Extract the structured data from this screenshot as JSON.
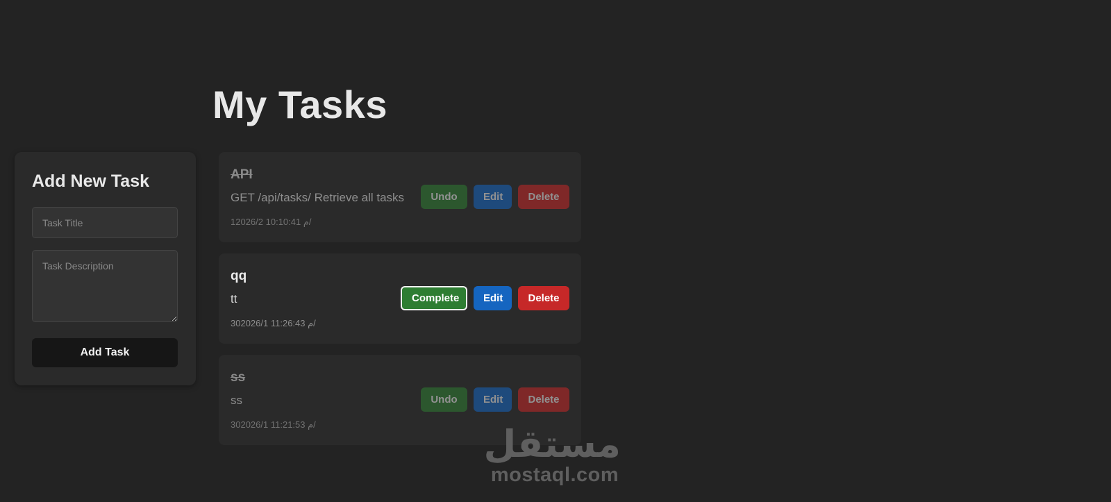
{
  "page_title": "My Tasks",
  "add_form": {
    "heading": "Add New Task",
    "title_placeholder": "Task Title",
    "description_placeholder": "Task Description",
    "submit_label": "Add Task"
  },
  "tasks": [
    {
      "title": "API",
      "description": "GET /api/tasks/ Retrieve all tasks",
      "date": "1م 10:10:41 2026/2/",
      "completed": true,
      "toggle_label": "Undo",
      "edit_label": "Edit",
      "delete_label": "Delete"
    },
    {
      "title": "qq",
      "description": "tt",
      "date": "30م 11:26:43 2026/1/",
      "completed": false,
      "toggle_label": "Complete",
      "edit_label": "Edit",
      "delete_label": "Delete"
    },
    {
      "title": "ss",
      "description": "ss",
      "date": "30م 11:21:53 2026/1/",
      "completed": true,
      "toggle_label": "Undo",
      "edit_label": "Edit",
      "delete_label": "Delete"
    }
  ],
  "watermark": {
    "arabic": "مستقل",
    "latin": "mostaql.com"
  },
  "colors": {
    "background": "#232323",
    "card": "#2a2a2a",
    "complete_green": "#2e7d32",
    "edit_blue": "#1565c0",
    "delete_red": "#c62828",
    "add_button": "#161616"
  }
}
